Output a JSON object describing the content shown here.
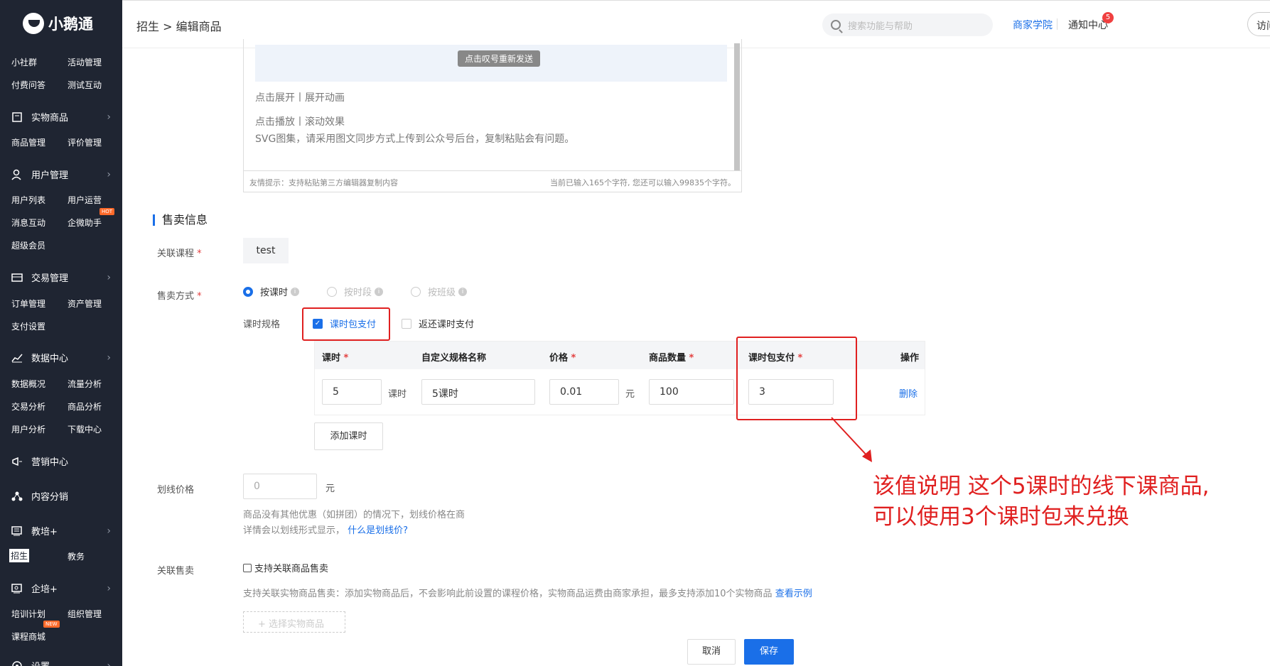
{
  "sidebar": {
    "logo_text": "小鹅通",
    "groups": [
      {
        "label": "",
        "items": [
          "小社群",
          "活动管理",
          "付费问答",
          "测试互动"
        ]
      },
      {
        "label": "实物商品",
        "icon": "box-icon",
        "items": [
          "商品管理",
          "评价管理"
        ]
      },
      {
        "label": "用户管理",
        "icon": "user-icon",
        "items": [
          "用户列表",
          "用户运营",
          "消息互动",
          "企微助手",
          "超级会员"
        ]
      },
      {
        "label": "交易管理",
        "icon": "card-icon",
        "items": [
          "订单管理",
          "资产管理",
          "支付设置"
        ]
      },
      {
        "label": "数据中心",
        "icon": "chart-icon",
        "items": [
          "数据概况",
          "流量分析",
          "交易分析",
          "商品分析",
          "用户分析",
          "下载中心"
        ]
      },
      {
        "label": "营销中心",
        "icon": "megaphone-icon",
        "items": []
      },
      {
        "label": "内容分销",
        "icon": "share-icon",
        "items": []
      },
      {
        "label": "教培+",
        "icon": "book-icon",
        "items": [
          "招生",
          "教务"
        ]
      },
      {
        "label": "企培+",
        "icon": "briefcase-icon",
        "items": [
          "培训计划",
          "组织管理",
          "课程商城"
        ]
      },
      {
        "label": "设置",
        "icon": "gear-icon",
        "items": []
      }
    ],
    "hot_badge": "HOT",
    "new_badge": "NEW",
    "active_item": "招生"
  },
  "topbar": {
    "breadcrumb": "招生 > 编辑商品",
    "search_placeholder": "搜索功能与帮助",
    "merchant_academy": "商家学院",
    "notification_center": "通知中心",
    "notification_count": "5",
    "visit": "访问"
  },
  "editor": {
    "resend_button": "点击叹号重新发送",
    "line1": "点击展开丨展开动画",
    "line2": "点击播放丨滚动效果",
    "line3": "SVG图集，请采用图文同步方式上传到公众号后台，复制粘贴会有问题。",
    "footer_tip": "友情提示：支持粘贴第三方编辑器复制内容",
    "footer_count": "当前已输入165个字符, 您还可以输入99835个字符。"
  },
  "sale_info": {
    "section_title": "售卖信息",
    "related_course_label": "关联课程",
    "related_course_value": "test",
    "sale_mode_label": "售卖方式",
    "sale_modes": [
      "按课时",
      "按时段",
      "按班级"
    ],
    "selected_mode": "按课时",
    "spec_label": "课时规格",
    "checkbox_package": "课时包支付",
    "checkbox_return": "返还课时支付",
    "table": {
      "headers": [
        "课时",
        "自定义规格名称",
        "价格",
        "商品数量",
        "课时包支付",
        "操作"
      ],
      "required": [
        true,
        false,
        true,
        true,
        true,
        false
      ],
      "row": {
        "lessons": "5",
        "lessons_unit": "课时",
        "spec_name": "5课时",
        "price": "0.01",
        "price_unit": "元",
        "quantity": "100",
        "package_pay": "3",
        "action": "删除"
      }
    },
    "add_lesson_button": "添加课时",
    "strike_price_label": "划线价格",
    "strike_price_value": "0",
    "strike_price_unit": "元",
    "strike_hint_1": "商品没有其他优惠（如拼团）的情况下，划线价格在商",
    "strike_hint_2": "详情会以划线形式显示，",
    "strike_hint_link": "什么是划线价?",
    "related_sale_label": "关联售卖",
    "related_sale_checkbox": "支持关联商品售卖",
    "related_sale_hint": "支持关联实物商品售卖：添加实物商品后，不会影响此前设置的课程价格，实物商品运费由商家承担，最多支持添加10个实物商品",
    "related_sale_link": "查看示例",
    "select_goods_button": "+ 选择实物商品"
  },
  "footer": {
    "cancel": "取消",
    "save": "保存"
  },
  "annotation": {
    "line1": "该值说明 这个5课时的线下课商品,",
    "line2": "可以使用3个课时包来兑换",
    "color": "#e02020"
  },
  "colors": {
    "accent": "#1a6fe8",
    "sidebar": "#1f2532",
    "annotation": "#e02020"
  }
}
